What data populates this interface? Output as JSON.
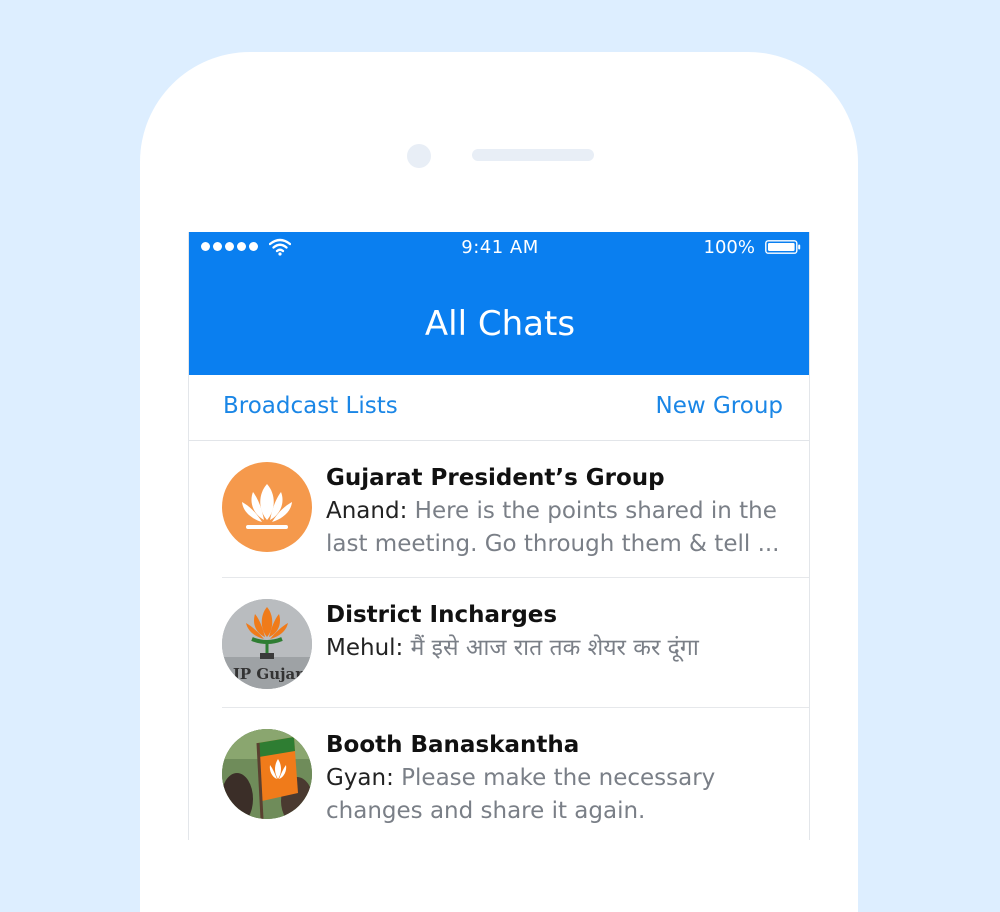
{
  "status_bar": {
    "time": "9:41 AM",
    "battery": "100%"
  },
  "header": {
    "title": "All Chats"
  },
  "actions": {
    "broadcast_lists": "Broadcast Lists",
    "new_group": "New Group"
  },
  "chats": [
    {
      "name": "Gujarat President’s Group",
      "sender": "Anand:",
      "message": "Here is the points shared in the last meeting. Go through them & tell ...",
      "avatar_icon": "lotus-icon"
    },
    {
      "name": "District Incharges",
      "sender": "Mehul:",
      "message": "मैं इसे आज रात तक शेयर कर दूंगा",
      "avatar_text": "JP Gujar"
    },
    {
      "name": "Booth Banaskantha",
      "sender": "Gyan:",
      "message": "Please make the necessary changes and share it again.",
      "avatar_icon": "flag-photo-icon"
    }
  ],
  "colors": {
    "background": "#ddeeff",
    "header": "#0a7ff0",
    "link": "#1a86e6",
    "lotus_avatar": "#f5994c"
  }
}
